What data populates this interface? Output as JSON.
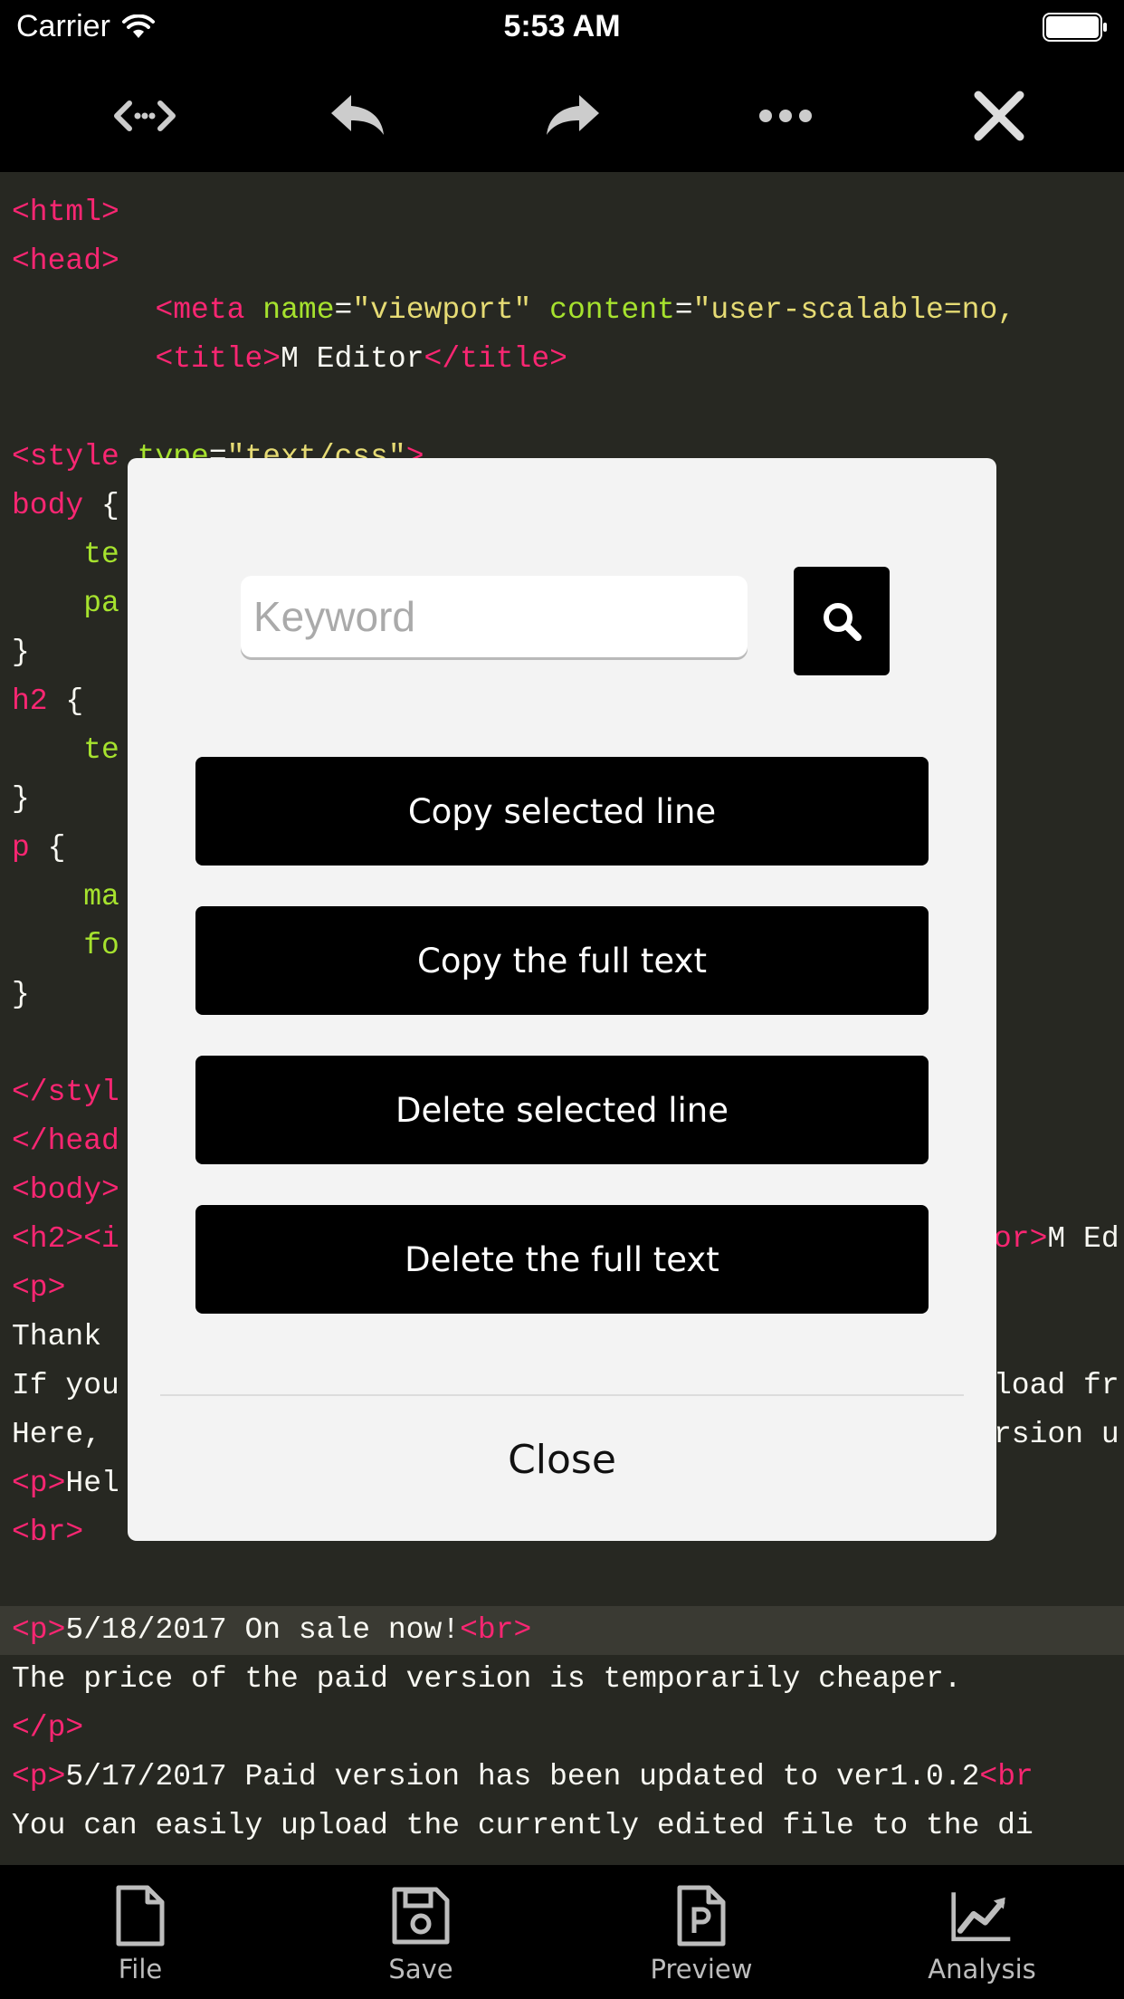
{
  "status_bar": {
    "carrier": "Carrier",
    "time": "5:53 AM"
  },
  "toolbar": {
    "buttons": [
      {
        "icon": "code-toggle-icon"
      },
      {
        "icon": "undo-icon"
      },
      {
        "icon": "redo-icon"
      },
      {
        "icon": "more-icon"
      },
      {
        "icon": "close-icon"
      }
    ]
  },
  "editor": {
    "lines": [
      "<html>",
      "<head>",
      "        <meta name=\"viewport\" content=\"user-scalable=no,",
      "        <title>M Editor</title>",
      "",
      "<style type=\"text/css\">",
      "body {",
      "    te",
      "    pa",
      "}",
      "h2 {",
      "    te",
      "}",
      "p {",
      "    ma",
      "    fo",
      "}",
      "",
      "</styl",
      "</head",
      "<body>",
      "<h2><i",
      "<p>",
      "Thank",
      "If you",
      "Here,",
      "<p>Hel",
      "<br>",
      "",
      "<p>5/18/2017 On sale now!<br>",
      "The price of the paid version is temporarily cheaper.",
      "</p>",
      "<p>5/17/2017 Paid version has been updated to ver1.0.2<br",
      "You can easily upload the currently edited file to the di"
    ],
    "right_fragments": {
      "h2_line": "or>M Ed",
      "if_line": "load fr",
      "here_line": "rsion u"
    },
    "highlighted_line_index": 29
  },
  "dialog": {
    "search": {
      "placeholder": "Keyword",
      "value": ""
    },
    "actions": [
      "Copy selected line",
      "Copy the full text",
      "Delete selected line",
      "Delete the full text"
    ],
    "close_label": "Close"
  },
  "tabbar": {
    "tabs": [
      {
        "label": "File",
        "icon": "file-icon"
      },
      {
        "label": "Save",
        "icon": "save-icon"
      },
      {
        "label": "Preview",
        "icon": "preview-icon"
      },
      {
        "label": "Analysis",
        "icon": "analysis-icon"
      }
    ]
  },
  "colors": {
    "editor_bg": "#272822",
    "tag": "#f92672",
    "attr": "#a6e22e",
    "string": "#e6db74",
    "text": "#f8f8f2"
  }
}
